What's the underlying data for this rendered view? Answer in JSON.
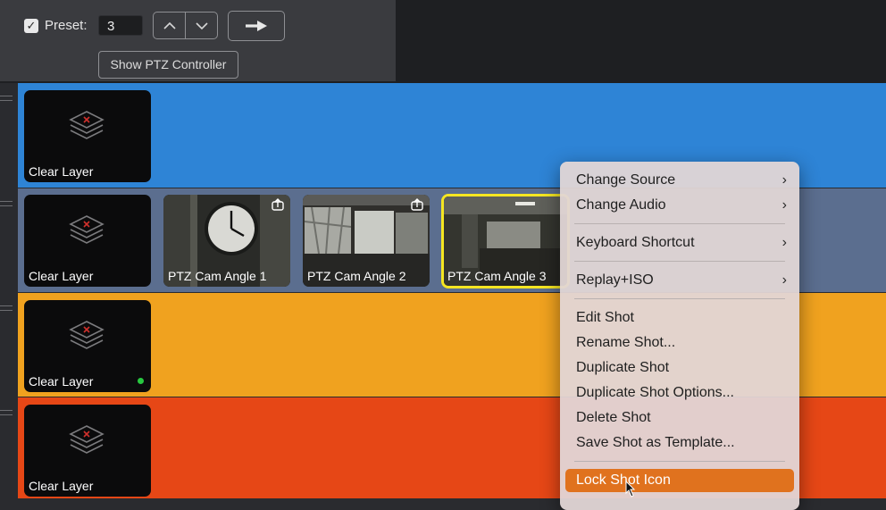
{
  "preset": {
    "checked": true,
    "label": "Preset:",
    "value": "3"
  },
  "buttons": {
    "show_ptz": "Show PTZ Controller"
  },
  "layers": [
    {
      "color": "#2e84d6",
      "shots": [
        {
          "label": "Clear Layer"
        }
      ]
    },
    {
      "color": "#5b6e8f",
      "shots": [
        {
          "label": "Clear Layer"
        },
        {
          "label": "PTZ Cam Angle 1"
        },
        {
          "label": "PTZ Cam Angle 2"
        },
        {
          "label": "PTZ Cam Angle 3"
        }
      ]
    },
    {
      "color": "#f0a21f",
      "shots": [
        {
          "label": "Clear Layer",
          "live": true
        }
      ]
    },
    {
      "color": "#e64716",
      "shots": [
        {
          "label": "Clear Layer"
        }
      ]
    }
  ],
  "context_menu": {
    "items": [
      {
        "label": "Change Source",
        "submenu": true
      },
      {
        "label": "Change Audio",
        "submenu": true
      },
      {
        "label": "Keyboard Shortcut",
        "submenu": true
      },
      {
        "label": "Replay+ISO",
        "submenu": true
      },
      {
        "label": "Edit Shot"
      },
      {
        "label": "Rename Shot..."
      },
      {
        "label": "Duplicate Shot"
      },
      {
        "label": "Duplicate Shot Options..."
      },
      {
        "label": "Delete Shot"
      },
      {
        "label": "Save Shot as Template..."
      },
      {
        "label": "Lock Shot Icon",
        "highlighted": true
      }
    ]
  },
  "icons": {
    "checkbox": "checkmark-icon",
    "step_up": "chevron-up-icon",
    "step_down": "chevron-down-icon",
    "go": "arrow-right-icon",
    "layers": "layers-icon",
    "share": "share-icon",
    "submenu": "chevron-right-icon",
    "cursor": "pointer-cursor-icon"
  },
  "colors": {
    "highlight": "#e0721e",
    "selected_border": "#f5e622",
    "live_dot": "#28c840"
  }
}
